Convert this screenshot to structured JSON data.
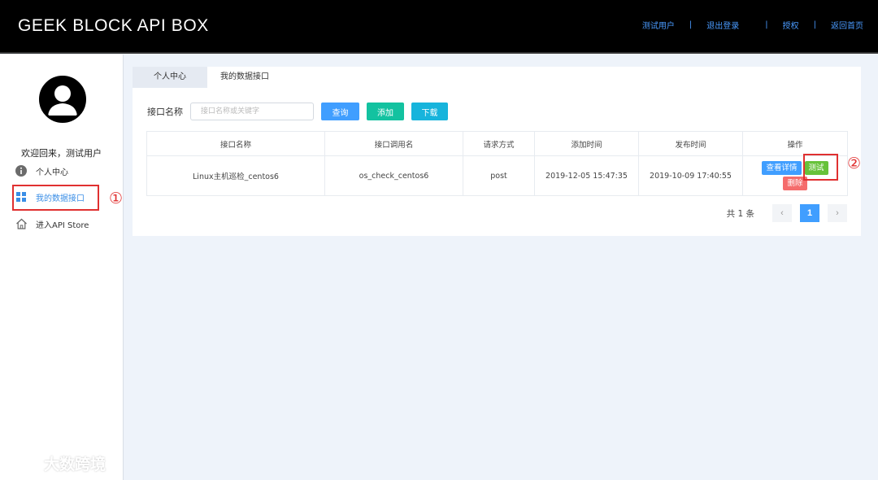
{
  "header": {
    "logo": "GEEK BLOCK API BOX",
    "nav": [
      {
        "label": "测试用户"
      },
      {
        "label": "退出登录"
      },
      {
        "label": "授权"
      },
      {
        "label": "返回首页"
      }
    ],
    "separator": "|"
  },
  "sidebar": {
    "welcome": "欢迎回来，测试用户",
    "items": [
      {
        "label": "个人中心",
        "icon": "info-icon"
      },
      {
        "label": "我的数据接口",
        "icon": "grid-icon",
        "active": true
      },
      {
        "label": "进入API Store",
        "icon": "home-icon"
      }
    ]
  },
  "annotations": {
    "marker1": "①",
    "marker2": "②",
    "color": "#e03030"
  },
  "tabs": [
    {
      "label": "个人中心"
    },
    {
      "label": "我的数据接口",
      "active": true
    }
  ],
  "search": {
    "label": "接口名称",
    "placeholder": "接口名称或关键字",
    "query_label": "查询",
    "add_label": "添加",
    "download_label": "下载"
  },
  "table": {
    "columns": [
      "接口名称",
      "接口调用名",
      "请求方式",
      "添加时间",
      "发布时间",
      "操作"
    ],
    "rows": [
      {
        "name": "Linux主机巡检_centos6",
        "call_name": "os_check_centos6",
        "method": "post",
        "added": "2019-12-05 15:47:35",
        "published": "2019-10-09 17:40:55"
      }
    ],
    "actions": {
      "detail": "查看详情",
      "test": "测试",
      "delete": "删除"
    }
  },
  "pagination": {
    "total": "共 1 条",
    "prev": "‹",
    "current": "1",
    "next": "›"
  },
  "watermark": "大数跨境",
  "colors": {
    "topbar": "#000000",
    "link": "#4a9bff",
    "primary": "#409eff",
    "success": "#67c23a",
    "danger": "#f56c6c",
    "teal": "#13c2a0",
    "cyan": "#17b4dc"
  }
}
